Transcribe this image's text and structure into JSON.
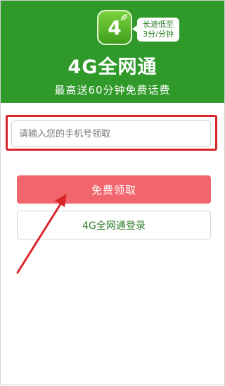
{
  "banner": {
    "app_icon_text": "4",
    "bubble_line1": "长途低至",
    "bubble_line2": "3分/分钟",
    "title": "4G全网通",
    "subtitle": "最高送60分钟免费话费",
    "color": "#2f9a2a"
  },
  "form": {
    "phone_placeholder": "请输入您的手机号领取",
    "phone_value": ""
  },
  "buttons": {
    "free_claim_label": "免费领取",
    "login_label": "4G全网通登录",
    "free_claim_color": "#f0666c",
    "login_text_color": "#2f7f2a"
  },
  "annotations": {
    "highlight_color": "#d9262a",
    "arrow_color": "#d9262a"
  }
}
